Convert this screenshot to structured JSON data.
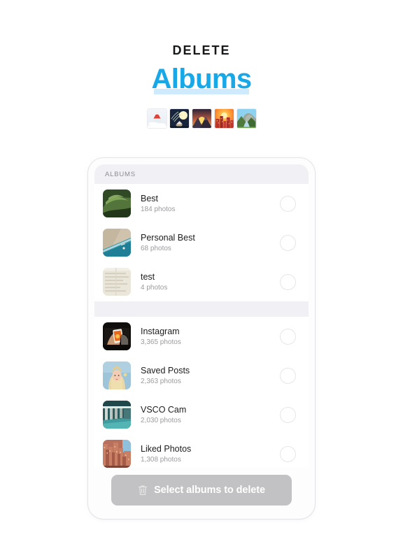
{
  "header": {
    "eyebrow": "DELETE",
    "headline": "Albums",
    "accent_color": "#18a8e8",
    "underline_color": "#cfeafc",
    "eyebrow_color": "#17181a",
    "emoji_tiles": [
      {
        "name": "mount-fuji-emoji",
        "glyph": "🗻"
      },
      {
        "name": "moon-viewing-ceremony-emoji",
        "glyph": "🎑"
      },
      {
        "name": "sunrise-over-mountains-emoji",
        "glyph": "🌄"
      },
      {
        "name": "sunset-city-emoji",
        "glyph": "🌇"
      },
      {
        "name": "national-park-emoji",
        "glyph": "🏞"
      }
    ]
  },
  "phone": {
    "section_label": "ALBUMS",
    "groups": [
      {
        "rows": [
          {
            "title": "Best",
            "subtitle": "184 photos",
            "thumb": "green-foliage"
          },
          {
            "title": "Personal Best",
            "subtitle": "68 photos",
            "thumb": "aerial-beach"
          },
          {
            "title": "test",
            "subtitle": "4 photos",
            "thumb": "paper-document"
          }
        ]
      },
      {
        "rows": [
          {
            "title": "Instagram",
            "subtitle": "3,365 photos",
            "thumb": "hand-holding-phone"
          },
          {
            "title": "Saved Posts",
            "subtitle": "2,363 photos",
            "thumb": "blonde-portrait"
          },
          {
            "title": "VSCO Cam",
            "subtitle": "2,030 photos",
            "thumb": "teal-architecture"
          },
          {
            "title": "Liked Photos",
            "subtitle": "1,308 photos",
            "thumb": "terracotta-cityscape"
          }
        ]
      }
    ],
    "cta": {
      "label": "Select albums to delete",
      "icon": "trash-icon",
      "enabled": false,
      "background_color": "#c2c2c4",
      "text_color": "#ffffff"
    }
  }
}
